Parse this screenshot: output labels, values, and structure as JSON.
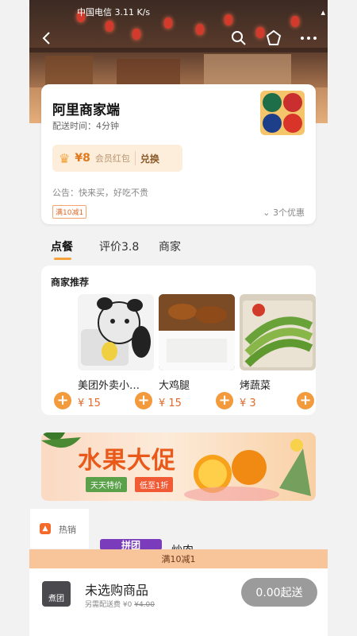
{
  "status_bar": {
    "left": "中国电信 3.11 K/s",
    "right": ""
  },
  "nav": {
    "back_icon": "back-icon",
    "search_icon": "search-icon",
    "favorite_icon": "star-icon",
    "more_icon": "more-icon"
  },
  "shop": {
    "name": "阿里商家端",
    "delivery_time": "配送时间：4分钟",
    "coupon": {
      "amount": "¥8",
      "label": "会员红包",
      "action": "兑换"
    },
    "notice": "公告：快来买，好吃不贵",
    "promo_tag": "满10减1",
    "promo_count": "3个优惠"
  },
  "tabs": [
    {
      "label": "点餐"
    },
    {
      "label": "评价3.8"
    },
    {
      "label": "商家"
    }
  ],
  "recommend": {
    "title": "商家推荐",
    "items": [
      {
        "name": "美团外卖小…",
        "price": "¥ 15"
      },
      {
        "name": "大鸡腿",
        "price": "¥ 15"
      },
      {
        "name": "烤蔬菜",
        "price": "¥ 3"
      }
    ]
  },
  "banner": {
    "title": "水果大促",
    "sub1": "天天特价",
    "sub2": "低至1折"
  },
  "category": {
    "hot_label": "热销"
  },
  "peek": {
    "tag": "拼团",
    "dish": "炒肉"
  },
  "promo_bar": "满10减1",
  "cart": {
    "title": "未选购商品",
    "fee_label": "另需配送费",
    "fee_new": "¥0",
    "fee_old": "¥4.00",
    "button": "0.00起送"
  },
  "colors": {
    "accent": "#f39a3c",
    "price": "#e06a2a"
  }
}
